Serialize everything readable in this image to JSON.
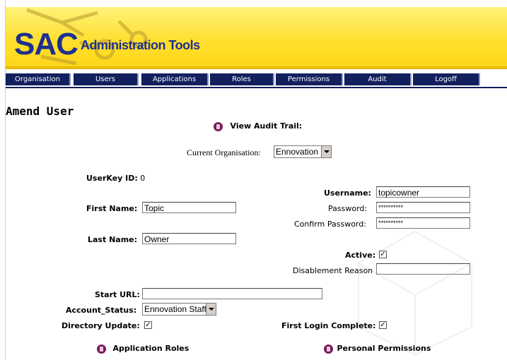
{
  "header": {
    "logo_main": "SAC",
    "logo_sub": "Administration Tools"
  },
  "nav": {
    "items": [
      "Organisation",
      "Users",
      "Applications",
      "Roles",
      "Permissions",
      "Audit",
      "Logoff"
    ]
  },
  "page": {
    "title": "Amend User",
    "audit_link": "View Audit Trail:",
    "current_org_label": "Current Organisation:",
    "current_org_value": "Ennovation"
  },
  "form": {
    "userkey_label": "UserKey ID:",
    "userkey_value": "0",
    "username_label": "Username:",
    "username_value": "topicowner",
    "first_name_label": "First Name:",
    "first_name_value": "Topic",
    "password_label": "Password:",
    "password_value": "**********",
    "confirm_password_label": "Confirm Password:",
    "confirm_password_value": "**********",
    "last_name_label": "Last Name:",
    "last_name_value": "Owner",
    "active_label": "Active:",
    "active_checked": true,
    "disablement_reason_label": "Disablement Reason",
    "disablement_reason_value": "",
    "start_url_label": "Start URL:",
    "start_url_value": "",
    "account_status_label": "Account_Status:",
    "account_status_value": "Ennovation Staff",
    "directory_update_label": "Directory Update:",
    "directory_update_checked": true,
    "first_login_label": "First Login Complete:",
    "first_login_checked": true
  },
  "links": {
    "application_roles": "Application Roles",
    "personal_permissions": "Personal Permissions"
  },
  "colors": {
    "nav_bg": "#13205e",
    "header_yellow": "#ffd619",
    "logo_blue": "#1f2f8f",
    "icon_purple": "#7a1a5c"
  },
  "icons": {
    "audit": "document-icon",
    "application_roles": "document-icon",
    "personal_permissions": "document-icon",
    "dropdown": "chevron-down-icon",
    "checkmark": "checkmark-icon"
  }
}
